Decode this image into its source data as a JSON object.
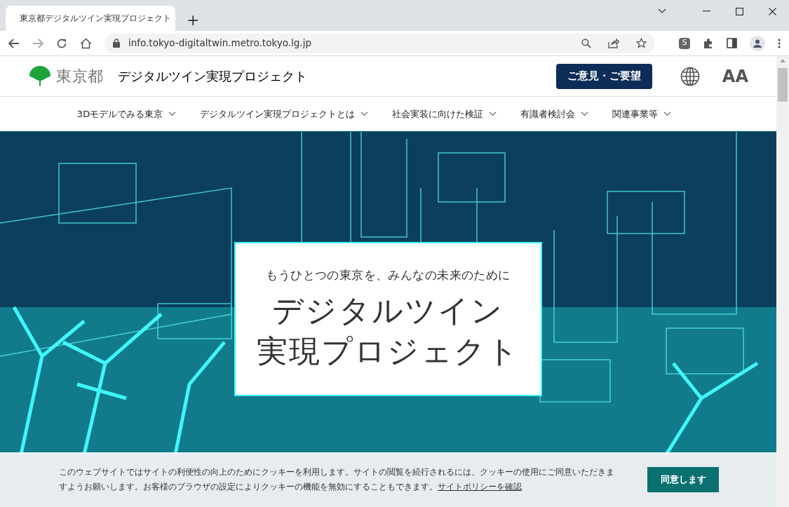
{
  "browser": {
    "tab": {
      "title": "東京都デジタルツイン実現プロジェクト",
      "selected": true
    },
    "new_tab": "+",
    "url": "info.tokyo-digitaltwin.metro.tokyo.lg.jp",
    "extension_badge": "S"
  },
  "header": {
    "logo_text": "東京都",
    "site_title": "デジタルツイン実現プロジェクト",
    "feedback_button": "ご意見・ご要望",
    "font_size_label": "AA"
  },
  "nav": [
    {
      "label": "3Dモデルでみる東京"
    },
    {
      "label": "デジタルツイン実現プロジェクトとは"
    },
    {
      "label": "社会実装に向けた検証"
    },
    {
      "label": "有識者検討会"
    },
    {
      "label": "関連事業等"
    }
  ],
  "hero": {
    "tagline": "もうひとつの東京を、みんなの未来のために",
    "title_lines": [
      "デジタルツイン",
      "実現プロジェクト"
    ]
  },
  "cookie_banner": {
    "text": "このウェブサイトではサイトの利便性の向上のためにクッキーを利用します。サイトの閲覧を続行されるには、クッキーの使用にご同意いただきますようお願いします。お客様のブラウザの設定によりクッキーの機能を無効にすることもできます。",
    "link": "サイトポリシーを確認",
    "accept_button": "同意します"
  }
}
